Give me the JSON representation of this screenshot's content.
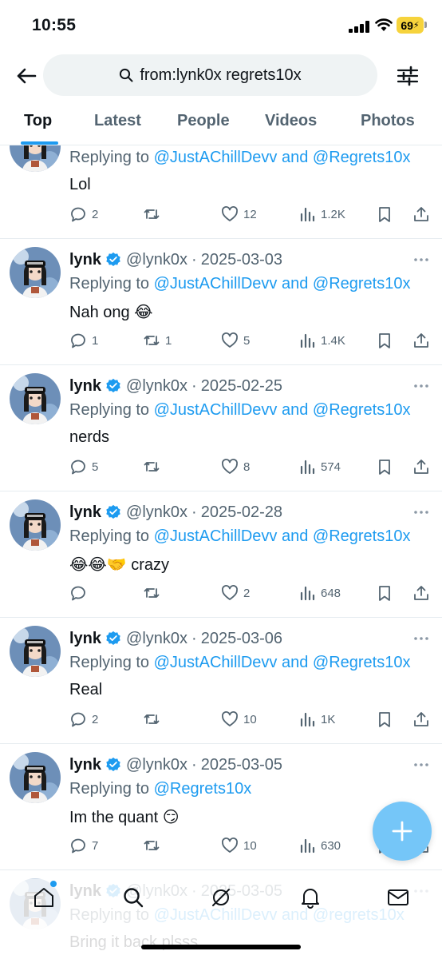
{
  "status_bar": {
    "time": "10:55",
    "battery": "69",
    "battery_color": "#f6d33c"
  },
  "search": {
    "query": "from:lynk0x regrets10x",
    "icons": [
      "back-arrow-icon",
      "search-icon",
      "filter-sliders-icon"
    ]
  },
  "tabs": [
    {
      "label": "Top",
      "active": true
    },
    {
      "label": "Latest",
      "active": false
    },
    {
      "label": "People",
      "active": false
    },
    {
      "label": "Videos",
      "active": false
    },
    {
      "label": "Photos",
      "active": false
    }
  ],
  "tweets": [
    {
      "name": "",
      "handle": "",
      "date": "",
      "reply_prefix": "Replying to ",
      "reply_mentions": "@JustAChillDevv and @Regrets10x",
      "text": "Lol",
      "replies": "2",
      "retweets": "",
      "likes": "12",
      "views": "1.2K"
    },
    {
      "name": "lynk",
      "handle": "@lynk0x",
      "date": "2025-03-03",
      "reply_prefix": "Replying to ",
      "reply_mentions": "@JustAChillDevv and @Regrets10x",
      "text": "Nah ong 😂",
      "replies": "1",
      "retweets": "1",
      "likes": "5",
      "views": "1.4K"
    },
    {
      "name": "lynk",
      "handle": "@lynk0x",
      "date": "2025-02-25",
      "reply_prefix": "Replying to ",
      "reply_mentions": "@JustAChillDevv and @Regrets10x",
      "text": "nerds",
      "replies": "5",
      "retweets": "",
      "likes": "8",
      "views": "574"
    },
    {
      "name": "lynk",
      "handle": "@lynk0x",
      "date": "2025-02-28",
      "reply_prefix": "Replying to ",
      "reply_mentions": "@JustAChillDevv and @Regrets10x",
      "text": "😂😂🤝 crazy",
      "replies": "",
      "retweets": "",
      "likes": "2",
      "views": "648"
    },
    {
      "name": "lynk",
      "handle": "@lynk0x",
      "date": "2025-03-06",
      "reply_prefix": "Replying to ",
      "reply_mentions": "@JustAChillDevv and @Regrets10x",
      "text": "Real",
      "replies": "2",
      "retweets": "",
      "likes": "10",
      "views": "1K"
    },
    {
      "name": "lynk",
      "handle": "@lynk0x",
      "date": "2025-03-05",
      "reply_prefix": "Replying to ",
      "reply_mentions": "@Regrets10x",
      "text": "Im the quant 😏",
      "replies": "7",
      "retweets": "",
      "likes": "10",
      "views": "630"
    },
    {
      "name": "lynk",
      "handle": "@lynk0x",
      "date": "2025-03-05",
      "reply_prefix": "Replying to ",
      "reply_mentions": "@JustAChillDevv and @regrets10x",
      "text": "Bring it back plsss",
      "replies": "",
      "retweets": "",
      "likes": "",
      "views": ""
    }
  ],
  "date_separator": "·",
  "fab": {
    "icon": "compose-plus-icon",
    "color": "#1d9bf0"
  },
  "bottom_nav": [
    "home-icon",
    "search-icon",
    "grok-icon",
    "notifications-bell-icon",
    "messages-mail-icon"
  ],
  "accent_color": "#1d9bf0"
}
